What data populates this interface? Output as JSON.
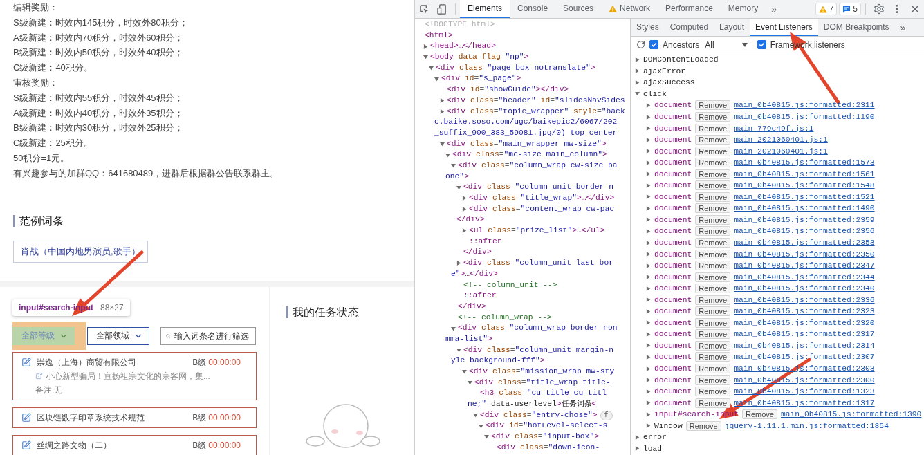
{
  "page": {
    "text_lines": [
      "编辑奖励：",
      "S级新建：时效内145积分，时效外80积分；",
      "A级新建：时效内70积分，时效外60积分；",
      "B级新建：时效内50积分，时效外40积分；",
      "C级新建：40积分。",
      "审核奖励：",
      "S级新建：时效内55积分，时效外45积分；",
      "A级新建：时效内40积分，时效外35积分；",
      "B级新建：时效内30积分，时效外25积分；",
      "C级新建：25积分。",
      "50积分=1元。",
      "有兴趣参与的加群QQ：641680489，进群后根据群公告联系群主。"
    ],
    "example_section": {
      "title": "范例词条",
      "entry": "肖战（中国内地男演员,歌手）"
    },
    "tasks_section": {
      "tooltip": {
        "selector": "input#search-input",
        "size": "88×27"
      },
      "filters": [
        {
          "kind": "select",
          "label": "全部等级",
          "highlighted": true
        },
        {
          "kind": "select",
          "label": "全部领域",
          "highlighted": false
        },
        {
          "kind": "search",
          "placeholder": "输入词条名进行筛选"
        }
      ],
      "cards": [
        {
          "title": "崇逸（上海）商贸有限公司",
          "grade": "B级",
          "time": "00:00:00",
          "link": "小心新型骗局！宣扬祖宗文化的宗客网，集...",
          "note": "备注:无"
        },
        {
          "title": "区块链数字印章系统技术规范",
          "grade": "B级",
          "time": "00:00:00"
        },
        {
          "title": "丝绸之路文物（二）",
          "grade": "B级",
          "time": "00:00:00"
        }
      ]
    },
    "status_section": {
      "title": "我的任务状态"
    }
  },
  "devtools": {
    "tabs": [
      {
        "label": "Elements",
        "selected": true,
        "warning": false
      },
      {
        "label": "Console",
        "selected": false,
        "warning": false
      },
      {
        "label": "Sources",
        "selected": false,
        "warning": false
      },
      {
        "label": "Network",
        "selected": false,
        "warning": true
      },
      {
        "label": "Performance",
        "selected": false,
        "warning": false
      },
      {
        "label": "Memory",
        "selected": false,
        "warning": false
      }
    ],
    "more": "»",
    "warnings": "7",
    "messages": "5",
    "elements": [
      {
        "kind": "doctype",
        "text": "<!DOCTYPE html>"
      },
      {
        "kind": "tag",
        "text": "<html>",
        "children": [
          {
            "kind": "tag",
            "text": "<head>…</head>",
            "expanded": false
          },
          {
            "kind": "tag",
            "text": "<body data-flag=\"np\">",
            "expanded": true,
            "children": [
              {
                "kind": "tag",
                "text": "<div class=\"page-box notranslate\">",
                "expanded": true,
                "children": [
                  {
                    "kind": "tag",
                    "text": "<div id=\"s_page\">",
                    "expanded": true,
                    "children": [
                      {
                        "kind": "tag",
                        "text": "<div id=\"showGuide\"></div>"
                      },
                      {
                        "kind": "tag",
                        "text": "<div class=\"header\" id=\"slidesNavSides",
                        "expanded": false
                      },
                      {
                        "kind": "tag",
                        "lines": [
                          "<div class=\"topic_wrapper\" style=\"back",
                          "c.baike.soso.com/ugc/baikepic2/6067/202",
                          "_suffix_900_383_59081.jpg/0) top center"
                        ],
                        "expanded": false
                      },
                      {
                        "kind": "tag",
                        "text": "<div class=\"main_wrapper mw-size\">",
                        "expanded": true,
                        "children": [
                          {
                            "kind": "tag",
                            "text": "<div class=\"mc-size main_column\">",
                            "expanded": true,
                            "children": [
                              {
                                "kind": "tag",
                                "lines": [
                                  "<div class=\"column_wrap cw-size ba",
                                  "one\">"
                                ],
                                "expanded": true,
                                "close": "</div>",
                                "children": [
                                  {
                                    "kind": "tag",
                                    "text": "<div class=\"column_unit border-n",
                                    "expanded": true,
                                    "close": "</div>",
                                    "children": [
                                      {
                                        "kind": "tag",
                                        "text": "<div class=\"title_wrap\">…</div>",
                                        "expanded": false
                                      },
                                      {
                                        "kind": "tag",
                                        "lines": [
                                          "<div class=\"content_wrap cw-pac",
                                          "</div>"
                                        ],
                                        "expanded": false
                                      },
                                      {
                                        "kind": "tag",
                                        "text": "<ul class=\"prize_list\">…</ul>",
                                        "expanded": false
                                      },
                                      {
                                        "kind": "pseudo",
                                        "text": "::after"
                                      }
                                    ]
                                  },
                                  {
                                    "kind": "tag",
                                    "lines": [
                                      "<div class=\"column_unit last bor",
                                      "e\">…</div>"
                                    ],
                                    "expanded": false
                                  },
                                  {
                                    "kind": "comment",
                                    "text": "<!-- column_unit -->"
                                  },
                                  {
                                    "kind": "pseudo",
                                    "text": "::after"
                                  }
                                ]
                              },
                              {
                                "kind": "comment",
                                "text": "<!-- column_wrap -->"
                              },
                              {
                                "kind": "tag",
                                "lines": [
                                  "<div class=\"column_wrap border-non",
                                  "mma-list\">"
                                ],
                                "expanded": true,
                                "children": [
                                  {
                                    "kind": "tag",
                                    "lines": [
                                      "<div class=\"column_unit margin-n",
                                      "yle background-fff\">"
                                    ],
                                    "expanded": true,
                                    "children": [
                                      {
                                        "kind": "tag",
                                        "text": "<div class=\"mission_wrap mw-sty",
                                        "expanded": true,
                                        "children": [
                                          {
                                            "kind": "tag",
                                            "text": "<div class=\"title_wrap title-",
                                            "expanded": true,
                                            "children": [
                                              {
                                                "kind": "tag",
                                                "lines": [
                                                  "<h3 class=\"cu-title cu-titl",
                                                  "ne;\" data-userlevel>任务词条<"
                                                ]
                                              },
                                              {
                                                "kind": "tag",
                                                "text": "<div class=\"entry-chose\">",
                                                "badge": "f",
                                                "expanded": true,
                                                "children": [
                                                  {
                                                    "kind": "tag",
                                                    "text": "<div id=\"hotLevel-select-s",
                                                    "expanded": true,
                                                    "children": [
                                                      {
                                                        "kind": "tag",
                                                        "text": "<div class=\"input-box\">",
                                                        "expanded": true,
                                                        "children": [
                                                          {
                                                            "kind": "tag",
                                                            "text": "<div class=\"down-icon-"
                                                          }
                                                        ]
                                                      }
                                                    ]
                                                  }
                                                ]
                                              }
                                            ]
                                          }
                                        ]
                                      }
                                    ]
                                  }
                                ]
                              }
                            ]
                          }
                        ]
                      }
                    ]
                  }
                ]
              }
            ]
          }
        ]
      }
    ],
    "sidebar": {
      "tabs": [
        {
          "label": "Styles",
          "selected": false
        },
        {
          "label": "Computed",
          "selected": false
        },
        {
          "label": "Layout",
          "selected": false
        },
        {
          "label": "Event Listeners",
          "selected": true
        },
        {
          "label": "DOM Breakpoints",
          "selected": false
        }
      ],
      "more": "»",
      "ancestors": {
        "label": "Ancestors",
        "checked": true
      },
      "filter": "All",
      "framework": {
        "label": "Framework listeners",
        "checked": true
      },
      "events": [
        {
          "name": "DOMContentLoaded",
          "expanded": false
        },
        {
          "name": "ajaxError",
          "expanded": false
        },
        {
          "name": "ajaxSuccess",
          "expanded": false
        },
        {
          "name": "click",
          "expanded": true,
          "listeners": [
            {
              "kind": "node",
              "node": "document",
              "remove": "Remove",
              "source": "main_0b40815.js:formatted:2311",
              "expanded": false
            },
            {
              "kind": "node",
              "node": "document",
              "remove": "Remove",
              "source": "main_0b40815.js:formatted:1190",
              "expanded": false
            },
            {
              "kind": "node",
              "node": "document",
              "remove": "Remove",
              "source": "main_779c49f.js:1",
              "expanded": false
            },
            {
              "kind": "node",
              "node": "document",
              "remove": "Remove",
              "source": "main_2021060401.js:1",
              "expanded": false
            },
            {
              "kind": "node",
              "node": "document",
              "remove": "Remove",
              "source": "main_2021060401.js:1",
              "expanded": false
            },
            {
              "kind": "node",
              "node": "document",
              "remove": "Remove",
              "source": "main_0b40815.js:formatted:1573",
              "expanded": false
            },
            {
              "kind": "node",
              "node": "document",
              "remove": "Remove",
              "source": "main_0b40815.js:formatted:1561",
              "expanded": false
            },
            {
              "kind": "node",
              "node": "document",
              "remove": "Remove",
              "source": "main_0b40815.js:formatted:1548",
              "expanded": false
            },
            {
              "kind": "node",
              "node": "document",
              "remove": "Remove",
              "source": "main_0b40815.js:formatted:1521",
              "expanded": false
            },
            {
              "kind": "node",
              "node": "document",
              "remove": "Remove",
              "source": "main_0b40815.js:formatted:1490",
              "expanded": false
            },
            {
              "kind": "node",
              "node": "document",
              "remove": "Remove",
              "source": "main_0b40815.js:formatted:2359",
              "expanded": false
            },
            {
              "kind": "node",
              "node": "document",
              "remove": "Remove",
              "source": "main_0b40815.js:formatted:2356",
              "expanded": false
            },
            {
              "kind": "node",
              "node": "document",
              "remove": "Remove",
              "source": "main_0b40815.js:formatted:2353",
              "expanded": false
            },
            {
              "kind": "node",
              "node": "document",
              "remove": "Remove",
              "source": "main_0b40815.js:formatted:2350",
              "expanded": false
            },
            {
              "kind": "node",
              "node": "document",
              "remove": "Remove",
              "source": "main_0b40815.js:formatted:2347",
              "expanded": false
            },
            {
              "kind": "node",
              "node": "document",
              "remove": "Remove",
              "source": "main_0b40815.js:formatted:2344",
              "expanded": false
            },
            {
              "kind": "node",
              "node": "document",
              "remove": "Remove",
              "source": "main_0b40815.js:formatted:2340",
              "expanded": false
            },
            {
              "kind": "node",
              "node": "document",
              "remove": "Remove",
              "source": "main_0b40815.js:formatted:2336",
              "expanded": false
            },
            {
              "kind": "node",
              "node": "document",
              "remove": "Remove",
              "source": "main_0b40815.js:formatted:2323",
              "expanded": false
            },
            {
              "kind": "node",
              "node": "document",
              "remove": "Remove",
              "source": "main_0b40815.js:formatted:2320",
              "expanded": false
            },
            {
              "kind": "node",
              "node": "document",
              "remove": "Remove",
              "source": "main_0b40815.js:formatted:2317",
              "expanded": false
            },
            {
              "kind": "node",
              "node": "document",
              "remove": "Remove",
              "source": "main_0b40815.js:formatted:2314",
              "expanded": false
            },
            {
              "kind": "node",
              "node": "document",
              "remove": "Remove",
              "source": "main_0b40815.js:formatted:2307",
              "expanded": false
            },
            {
              "kind": "node",
              "node": "document",
              "remove": "Remove",
              "source": "main_0b40815.js:formatted:2303",
              "expanded": false
            },
            {
              "kind": "node",
              "node": "document",
              "remove": "Remove",
              "source": "main_0b40815.js:formatted:2300",
              "expanded": false
            },
            {
              "kind": "node",
              "node": "document",
              "remove": "Remove",
              "source": "main_0b40815.js:formatted:1323",
              "expanded": false
            },
            {
              "kind": "node",
              "node": "document",
              "remove": "Remove",
              "source": "main_0b40815.js:formatted:1317",
              "expanded": false
            },
            {
              "kind": "node",
              "node": "input#search-input",
              "remove": "Remove",
              "source": "main_0b40815.js:formatted:1390",
              "expanded": false
            },
            {
              "kind": "window",
              "node": "Window",
              "remove": "Remove",
              "source": "jquery-1.11.1.min.js:formatted:1854",
              "expanded": false
            }
          ]
        },
        {
          "name": "error",
          "expanded": false
        },
        {
          "name": "load",
          "expanded": false
        }
      ]
    }
  }
}
